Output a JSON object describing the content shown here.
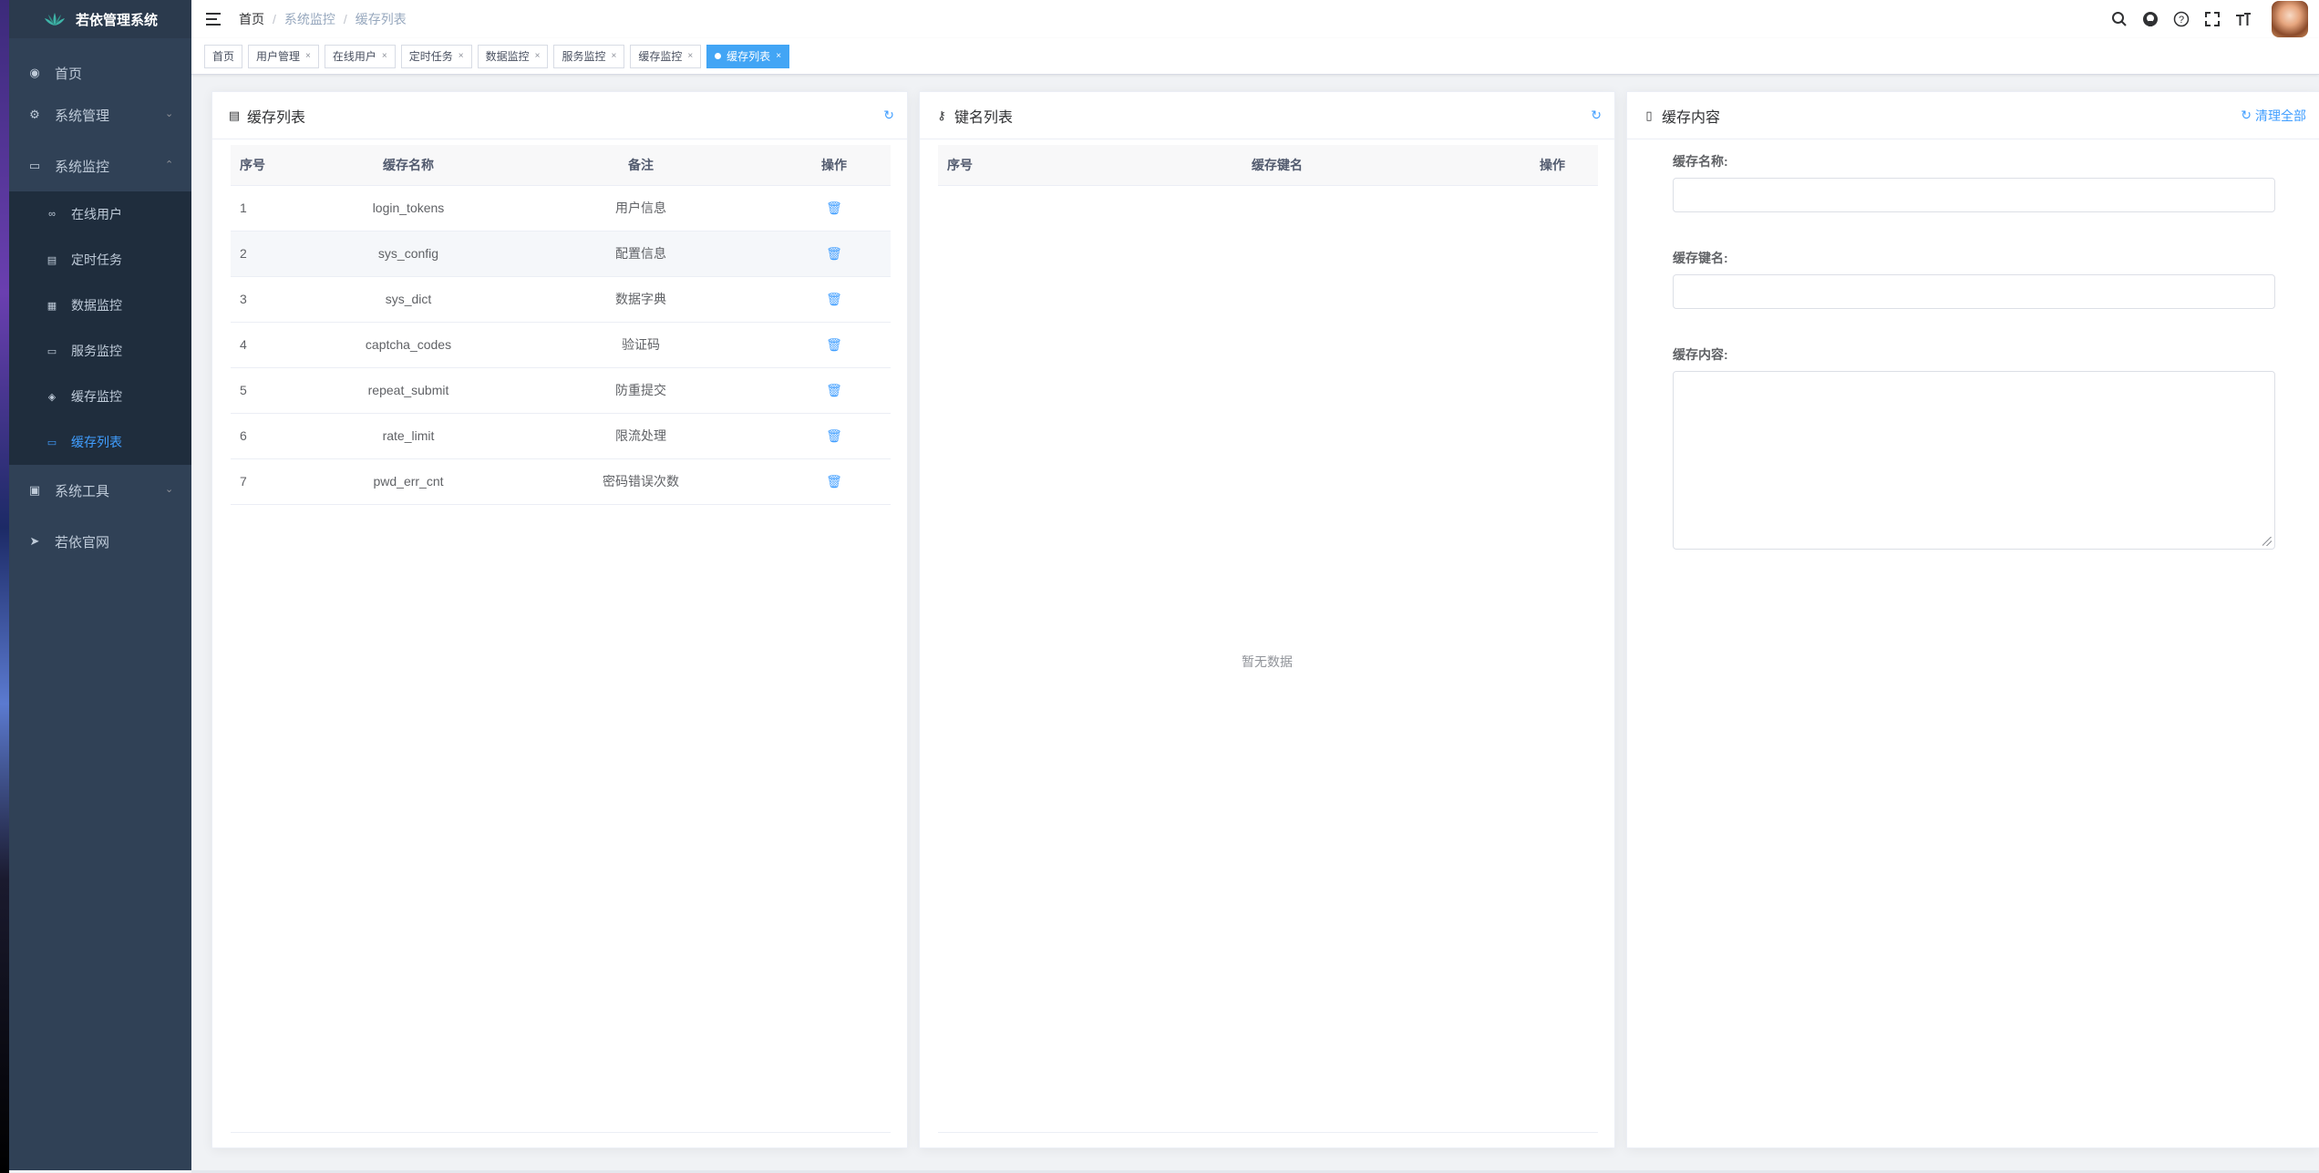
{
  "app": {
    "title": "若依管理系统"
  },
  "sidebar": {
    "items": [
      {
        "label": "首页",
        "icon": "dashboard-icon"
      },
      {
        "label": "系统管理",
        "icon": "gear-icon"
      },
      {
        "label": "系统监控",
        "icon": "monitor-icon"
      },
      {
        "label": "系统工具",
        "icon": "toolbox-icon"
      },
      {
        "label": "若依官网",
        "icon": "send-icon"
      }
    ],
    "monitor_sub": [
      {
        "label": "在线用户",
        "icon": "online-icon"
      },
      {
        "label": "定时任务",
        "icon": "job-icon"
      },
      {
        "label": "数据监控",
        "icon": "druid-icon"
      },
      {
        "label": "服务监控",
        "icon": "server-icon"
      },
      {
        "label": "缓存监控",
        "icon": "redis-icon"
      },
      {
        "label": "缓存列表",
        "icon": "redis-list-icon"
      }
    ]
  },
  "breadcrumb": [
    "首页",
    "系统监控",
    "缓存列表"
  ],
  "tags": [
    "首页",
    "用户管理",
    "在线用户",
    "定时任务",
    "数据监控",
    "服务监控",
    "缓存监控",
    "缓存列表"
  ],
  "cache_panel": {
    "title": "缓存列表",
    "columns": [
      "序号",
      "缓存名称",
      "备注",
      "操作"
    ],
    "rows": [
      {
        "no": "1",
        "name": "login_tokens",
        "remark": "用户信息"
      },
      {
        "no": "2",
        "name": "sys_config",
        "remark": "配置信息"
      },
      {
        "no": "3",
        "name": "sys_dict",
        "remark": "数据字典"
      },
      {
        "no": "4",
        "name": "captcha_codes",
        "remark": "验证码"
      },
      {
        "no": "5",
        "name": "repeat_submit",
        "remark": "防重提交"
      },
      {
        "no": "6",
        "name": "rate_limit",
        "remark": "限流处理"
      },
      {
        "no": "7",
        "name": "pwd_err_cnt",
        "remark": "密码错误次数"
      }
    ]
  },
  "key_panel": {
    "title": "键名列表",
    "columns": [
      "序号",
      "缓存键名",
      "操作"
    ],
    "empty_text": "暂无数据"
  },
  "content_panel": {
    "title": "缓存内容",
    "clear_label": "清理全部",
    "name_label": "缓存名称:",
    "key_label": "缓存键名:",
    "content_label": "缓存内容:"
  },
  "colors": {
    "accent": "#409eff",
    "sidebar_bg": "#304156"
  }
}
